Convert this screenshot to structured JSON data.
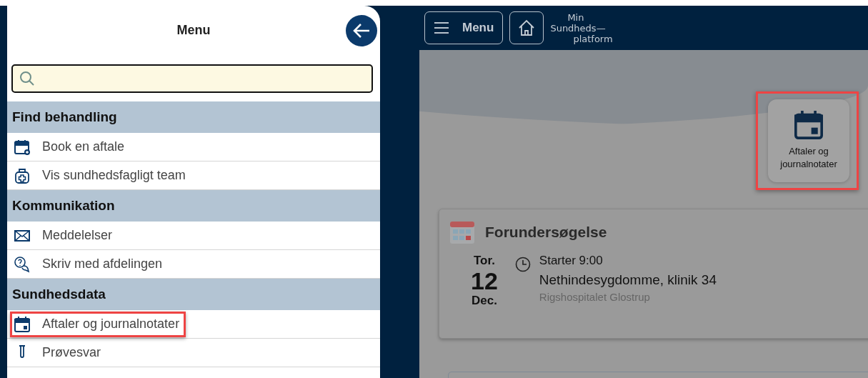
{
  "menu": {
    "title": "Menu",
    "sections": [
      {
        "title": "Find behandling",
        "items": [
          {
            "label": "Book en aftale",
            "kind": "calendar-plus",
            "highlighted": false
          },
          {
            "label": "Vis sundhedsfagligt team",
            "kind": "team",
            "highlighted": false
          }
        ]
      },
      {
        "title": "Kommunikation",
        "items": [
          {
            "label": "Meddelelser",
            "kind": "mail",
            "highlighted": false
          },
          {
            "label": "Skriv med afdelingen",
            "kind": "chat",
            "highlighted": false
          }
        ]
      },
      {
        "title": "Sundhedsdata",
        "items": [
          {
            "label": "Aftaler og journalnotater",
            "kind": "calendar",
            "highlighted": true
          },
          {
            "label": "Prøvesvar",
            "kind": "flask",
            "highlighted": false
          }
        ]
      }
    ]
  },
  "header": {
    "menu_button": "Menu",
    "logo": [
      "Min",
      "Sundheds—",
      "platform"
    ]
  },
  "tile": {
    "label": "Aftaler og journalnotater",
    "highlighted": true
  },
  "appointment": {
    "title": "Forundersøgelse",
    "weekday": "Tor.",
    "day": "12",
    "month": "Dec.",
    "time": "Starter 9:00",
    "clinic": "Nethindesygdomme, klinik 34",
    "hospital": "Rigshospitalet Glostrup"
  }
}
